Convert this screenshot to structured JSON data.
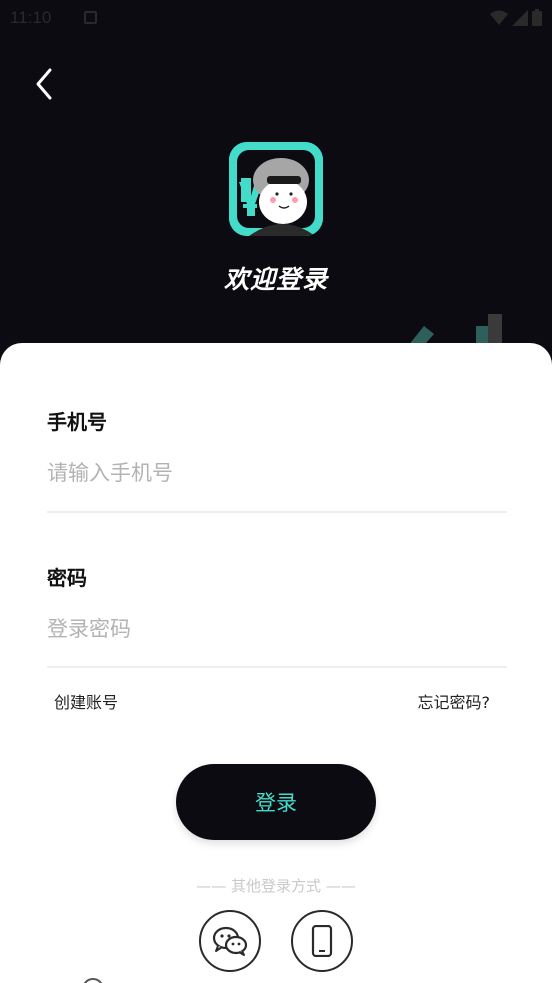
{
  "status_bar": {
    "time": "11:10"
  },
  "header": {
    "welcome_text": "欢迎登录"
  },
  "form": {
    "phone_label": "手机号",
    "phone_placeholder": "请输入手机号",
    "password_label": "密码",
    "password_placeholder": "登录密码"
  },
  "links": {
    "create_account": "创建账号",
    "forgot_password": "忘记密码?"
  },
  "login_button": "登录",
  "other_login": {
    "label": "—— 其他登录方式 ——"
  },
  "colors": {
    "accent": "#43dccb",
    "dark": "#0d0b12",
    "card": "#ffffff"
  },
  "icons": [
    "back-arrow-icon",
    "wechat-icon",
    "mobile-phone-icon",
    "wifi-icon",
    "signal-icon",
    "battery-icon"
  ]
}
